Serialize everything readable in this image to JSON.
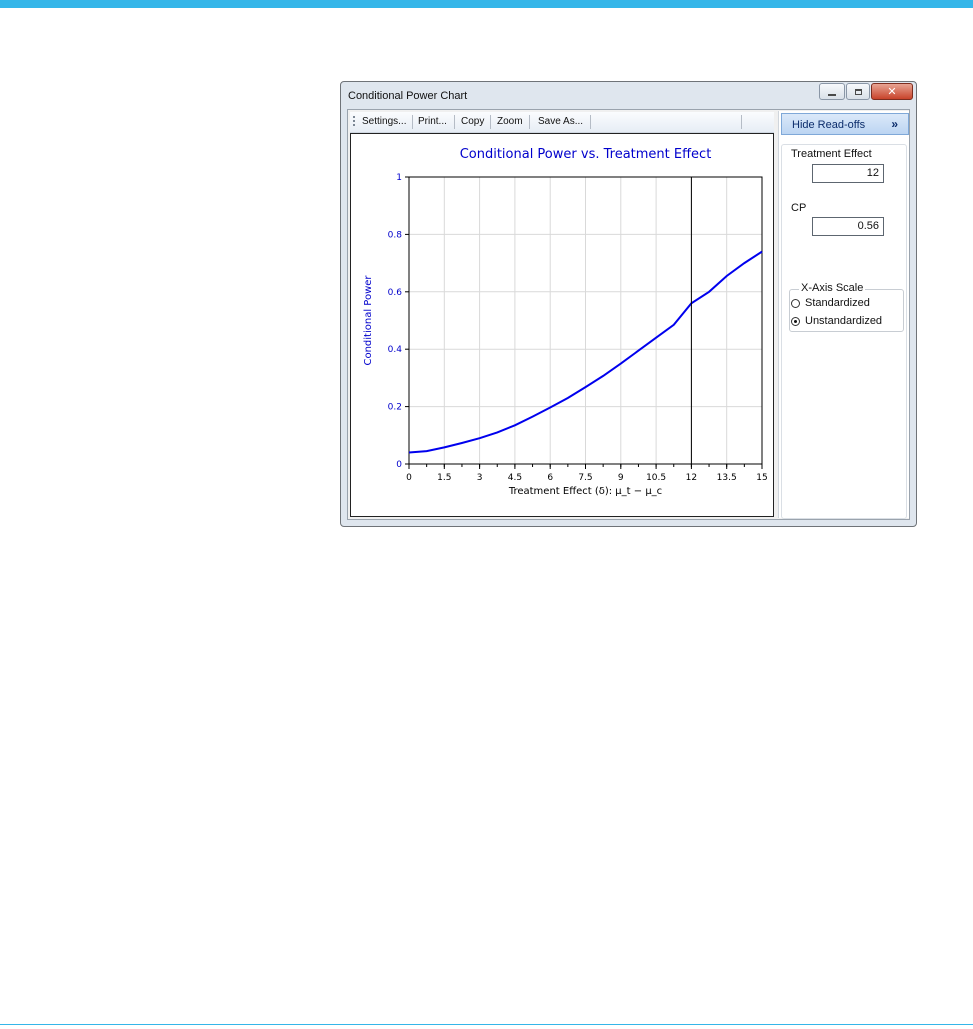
{
  "window": {
    "title": "Conditional Power Chart",
    "close_glyph": "✕"
  },
  "toolbar": {
    "items": [
      "Settings...",
      "Print...",
      "Copy",
      "Zoom",
      "Save As..."
    ]
  },
  "side_panel": {
    "hide_button_label": "Hide Read-offs",
    "hide_button_glyph": "»",
    "treatment_effect_label": "Treatment Effect",
    "treatment_effect_value": "12",
    "cp_label": "CP",
    "cp_value": "0.56",
    "x_axis_scale_label": "X-Axis Scale",
    "options": [
      "Standardized",
      "Unstandardized"
    ],
    "selected_option": "Unstandardized"
  },
  "colors": {
    "accent_bar": "#35b6e9",
    "series_line": "#0000ee",
    "title_text": "#0000cc",
    "readoff_line": "#000000"
  },
  "chart_data": {
    "type": "line",
    "title": "Conditional Power vs. Treatment Effect",
    "xlabel": "Treatment Effect (δ): μ_t − μ_c",
    "ylabel": "Conditional Power",
    "xlim": [
      0,
      15
    ],
    "ylim": [
      0,
      1
    ],
    "x_ticks": [
      "0",
      "1.5",
      "3",
      "4.5",
      "6",
      "7.5",
      "9",
      "10.5",
      "12",
      "13.5",
      "15"
    ],
    "y_ticks": [
      "0",
      "0.2",
      "0.4",
      "0.6",
      "0.8",
      "1"
    ],
    "grid": true,
    "readoff_x": 12,
    "series": [
      {
        "x": [
          0,
          0.75,
          1.5,
          2.25,
          3,
          3.75,
          4.5,
          5.25,
          6,
          6.75,
          7.5,
          8.25,
          9,
          9.75,
          10.5,
          11.25,
          12,
          12.75,
          13.5,
          14.25,
          15
        ],
        "y": [
          0.04,
          0.045,
          0.058,
          0.073,
          0.09,
          0.11,
          0.135,
          0.165,
          0.197,
          0.23,
          0.268,
          0.307,
          0.35,
          0.395,
          0.44,
          0.485,
          0.56,
          0.6,
          0.655,
          0.7,
          0.74
        ]
      }
    ]
  }
}
